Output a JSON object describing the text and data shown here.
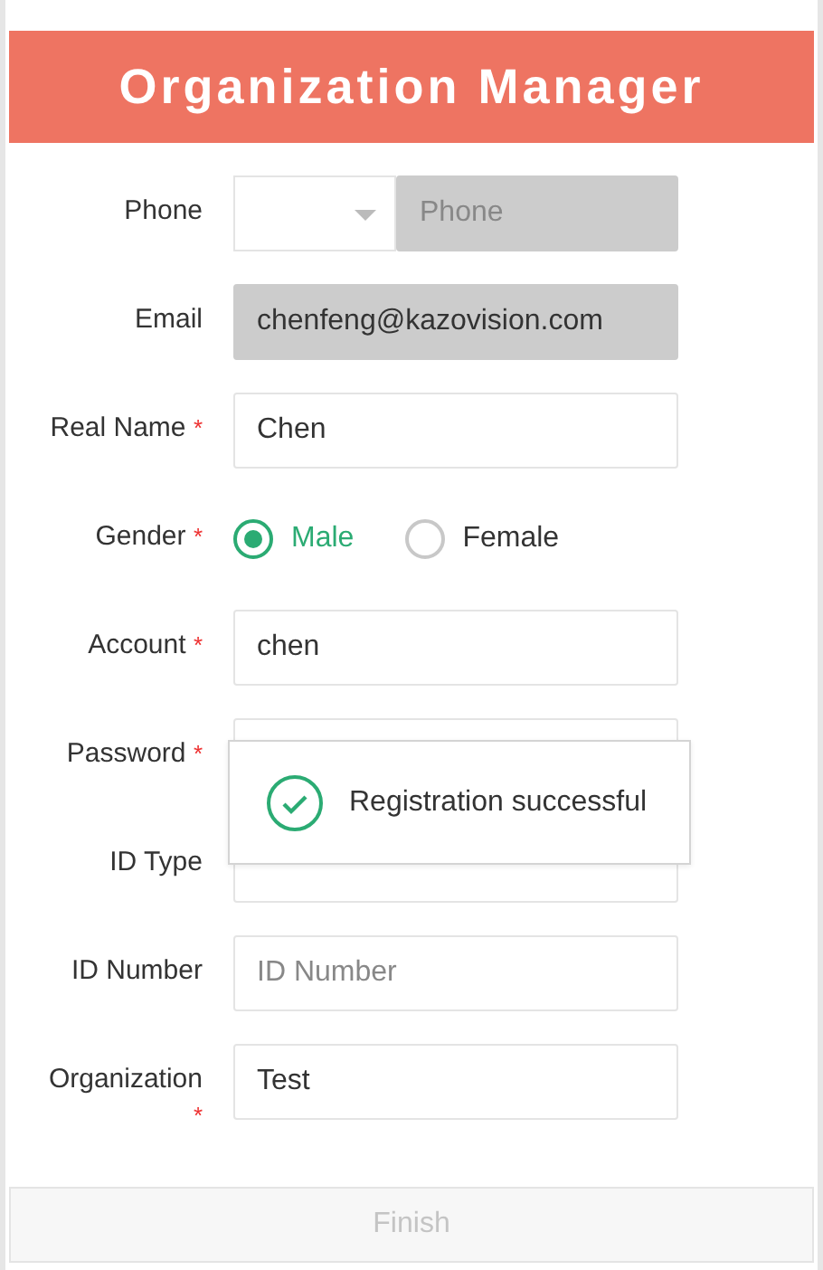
{
  "header": {
    "title": "Organization Manager"
  },
  "fields": [
    {
      "kind": "phone",
      "label": "Phone",
      "placeholder": "Phone",
      "disabled": true
    },
    {
      "kind": "text",
      "label": "Email",
      "value": "chenfeng@kazovision.com",
      "disabled": true
    },
    {
      "kind": "text",
      "label": "Real Name",
      "required_mark": "*",
      "value": "Chen",
      "disabled": false
    },
    {
      "kind": "radio",
      "label": "Gender",
      "required_mark": "*",
      "options": [
        {
          "label": "Male",
          "selected": true
        },
        {
          "label": "Female",
          "selected": false
        }
      ]
    },
    {
      "kind": "text",
      "label": "Account",
      "required_mark": "*",
      "value": "chen",
      "disabled": false
    },
    {
      "kind": "text",
      "label": "Password",
      "required_mark": "*",
      "disabled": false
    },
    {
      "kind": "text",
      "label": "ID Type",
      "disabled": false
    },
    {
      "kind": "text",
      "label": "ID Number",
      "placeholder": "ID Number",
      "disabled": false
    },
    {
      "kind": "text",
      "label": "Organization",
      "required_mark": "*",
      "value": "Test",
      "disabled": false
    }
  ],
  "toast": {
    "message": "Registration successful"
  },
  "finish_button": {
    "label": "Finish",
    "disabled": true
  }
}
